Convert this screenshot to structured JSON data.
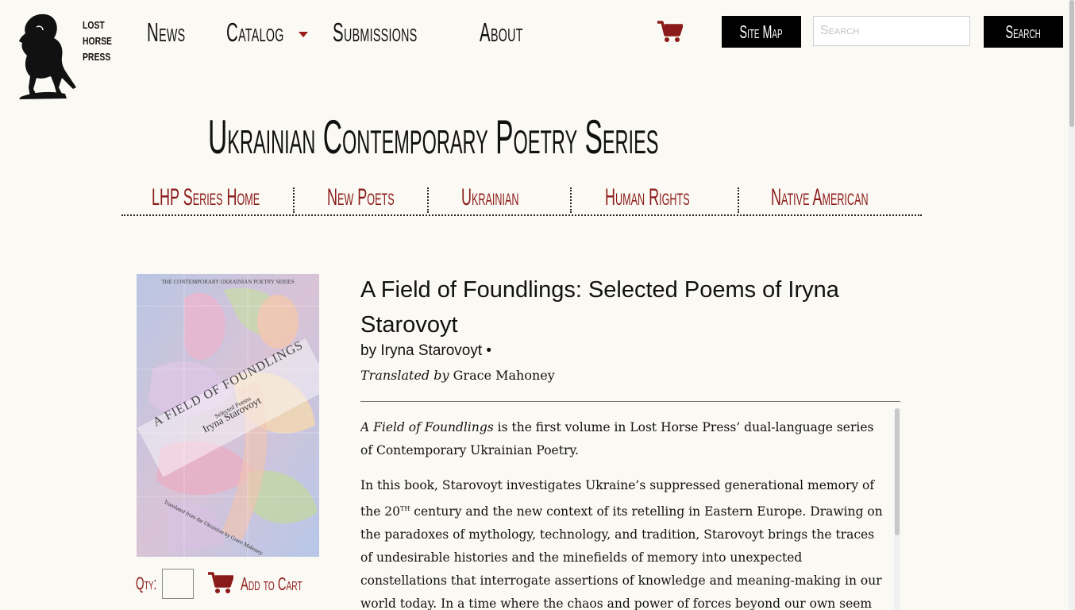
{
  "header": {
    "logo": {
      "line1": "LOST",
      "line2": "HORSE",
      "line3": "PRESS"
    },
    "nav": [
      {
        "label": "News"
      },
      {
        "label": "Catalog"
      },
      {
        "label": "Submissions"
      },
      {
        "label": "About"
      }
    ],
    "site_map_label": "Site Map",
    "search": {
      "placeholder": "Search",
      "value": ""
    },
    "search_button_label": "Search"
  },
  "series": {
    "title": "Ukrainian Contemporary Poetry Series",
    "nav": [
      {
        "label": "LHP Series Home"
      },
      {
        "label": "New Poets"
      },
      {
        "label": "Ukrainian"
      },
      {
        "label": "Human Rights"
      },
      {
        "label": "Native American"
      }
    ]
  },
  "product": {
    "cover": {
      "series_line": "THE CONTEMPORARY UKRAINIAN POETRY SERIES",
      "title": "A FIELD OF FOUNDLINGS",
      "subtitle": "Selected Poems",
      "author": "Iryna Starovoyt",
      "translator_line": "Translated from the Ukrainian by Grace Mahoney"
    },
    "title": "A Field of Foundlings: Selected Poems of Iryna Starovoyt",
    "byline": "by Iryna Starovoyt •",
    "translated_by_label": "Translated by",
    "translator": "Grace Mahoney",
    "qty_label": "Qty:",
    "qty_value": "",
    "add_to_cart_label": "Add to Cart",
    "description": {
      "p1_italic": "A Field of Foundlings",
      "p1_rest": " is the first volume in Lost Horse Press’ dual-language series of Contemporary Ukrainian Poetry.",
      "p2_a": "In this book, Starovoyt investigates Ukraine’s suppressed generational memory of the 20",
      "p2_sup": "TH",
      "p2_b": " century and the new context of its retelling in Eastern Europe. Drawing on the paradoxes of mythology, technology, and tradition, Starovoyt brings the traces of undesirable histories and the minefields of memory into unexpected constellations that interrogate assertions of knowledge and meaning-making in our world today. In a time where the chaos and power of forces beyond our own seem to diminish"
    }
  },
  "colors": {
    "background": "#fbf9f3",
    "accent": "#8b1a1a",
    "button": "#000000"
  }
}
